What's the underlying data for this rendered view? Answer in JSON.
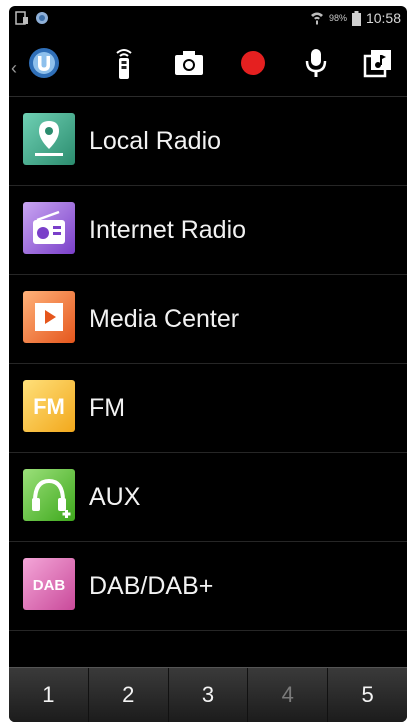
{
  "status_bar": {
    "battery_percent": "98%",
    "time": "10:58"
  },
  "toolbar": {
    "icons": [
      "undok-logo-icon",
      "remote-icon",
      "camera-icon",
      "record-icon",
      "microphone-icon",
      "music-library-icon"
    ],
    "record_color": "#e52020"
  },
  "menu": {
    "items": [
      {
        "label": "Local Radio",
        "icon": "location-pin-icon"
      },
      {
        "label": "Internet Radio",
        "icon": "radio-icon"
      },
      {
        "label": "Media Center",
        "icon": "play-icon"
      },
      {
        "label": "FM",
        "icon": "fm-icon"
      },
      {
        "label": "AUX",
        "icon": "headphones-icon"
      },
      {
        "label": "DAB/DAB+",
        "icon": "dab-icon"
      }
    ]
  },
  "icons": {
    "fm_text": "FM",
    "dab_text": "DAB"
  },
  "presets": [
    "1",
    "2",
    "3",
    "4",
    "5"
  ]
}
